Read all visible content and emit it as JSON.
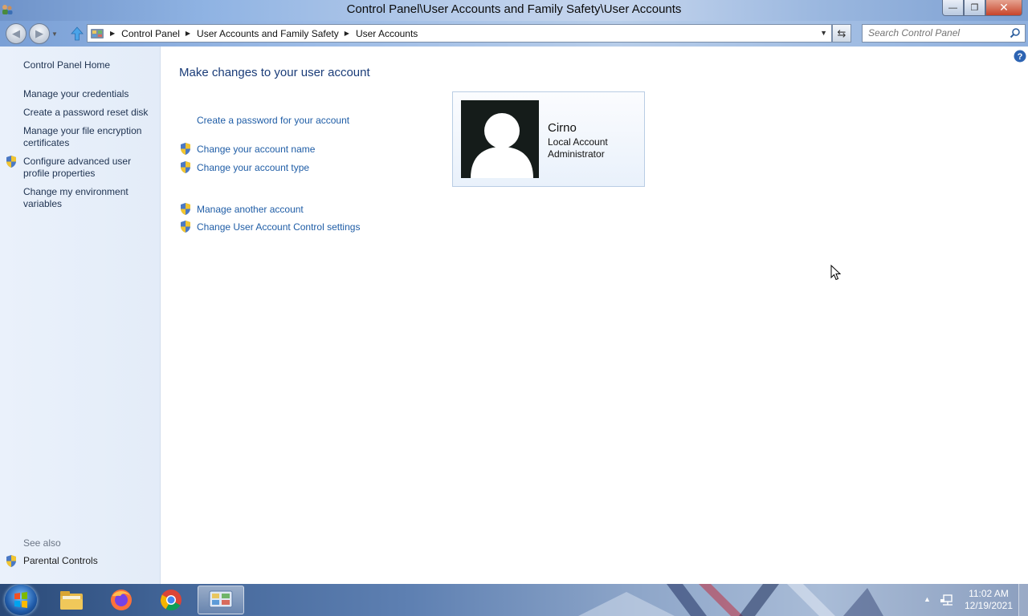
{
  "window": {
    "title": "Control Panel\\User Accounts and Family Safety\\User Accounts",
    "minimize_glyph": "—",
    "maximize_glyph": "❐",
    "close_glyph": "✕"
  },
  "address_bar": {
    "breadcrumbs": [
      "Control Panel",
      "User Accounts and Family Safety",
      "User Accounts"
    ],
    "search_placeholder": "Search Control Panel"
  },
  "left_pane": {
    "home": "Control Panel Home",
    "links": [
      "Manage your credentials",
      "Create a password reset disk",
      "Manage your file encryption certificates",
      "Configure advanced user profile properties",
      "Change my environment variables"
    ],
    "see_also_label": "See also",
    "see_also_links": [
      "Parental Controls"
    ]
  },
  "main": {
    "title": "Make changes to your user account",
    "tasks": [
      "Create a password for your account",
      "Change your account name",
      "Change your account type",
      "Manage another account",
      "Change User Account Control settings"
    ]
  },
  "user": {
    "name": "Cirno",
    "account_type": "Local Account",
    "role": "Administrator"
  },
  "taskbar": {
    "apps": [
      "windows-explorer-icon",
      "firefox-icon",
      "chrome-icon",
      "control-panel-icon"
    ],
    "time": "11:02 AM",
    "date": "12/19/2021"
  },
  "colors": {
    "link": "#1f5da6",
    "title": "#1a3c78",
    "left_pane_bg": "#e3ecf8"
  }
}
